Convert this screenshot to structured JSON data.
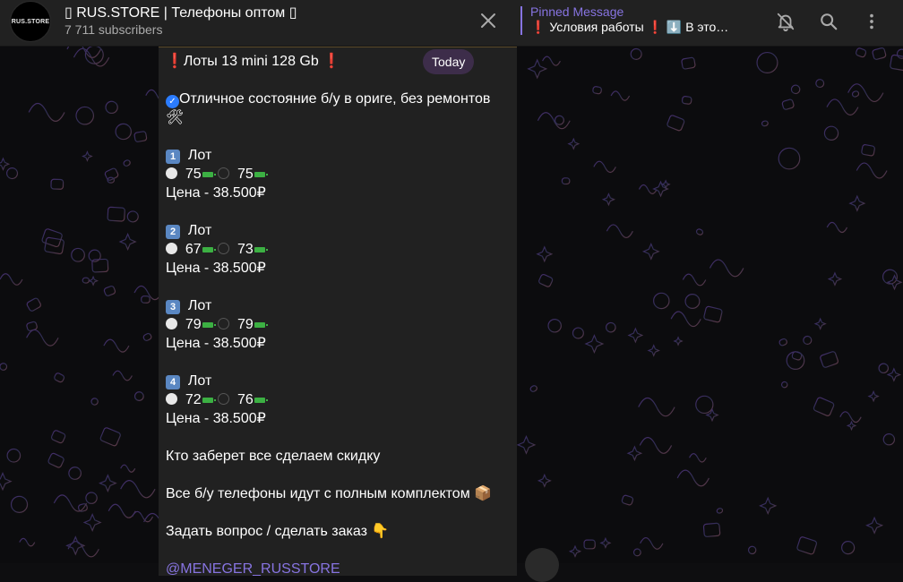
{
  "channel": {
    "avatar_text": "RUS.STORE",
    "title": "▯ RUS.STORE | Телефоны оптом ▯",
    "subscribers": "7 711 subscribers"
  },
  "pinned": {
    "title": "Pinned Message",
    "text": "❗ Условия работы ❗ ⬇️ В это…"
  },
  "header_icons": [
    "close-icon",
    "mute-bell-icon",
    "search-icon",
    "more-vertical-icon"
  ],
  "date_pill": "Today",
  "message": {
    "title": "Лоты  13 mini 128 Gb",
    "condition": "Отличное состояние б/у в ориге, без ремонтов",
    "lots": [
      {
        "num": "1",
        "label": "Лот",
        "white": "75",
        "black": "75",
        "price": "Цена - 38.500₽"
      },
      {
        "num": "2",
        "label": "Лот",
        "white": "67",
        "black": "73",
        "price": "Цена - 38.500₽"
      },
      {
        "num": "3",
        "label": "Лот",
        "white": "79",
        "black": "79",
        "price": "Цена - 38.500₽"
      },
      {
        "num": "4",
        "label": "Лот",
        "white": "72",
        "black": "76",
        "price": "Цена - 38.500₽"
      }
    ],
    "discount": "Кто заберет все сделаем скидку",
    "kit": "Все б/у телефоны идут с полным комплектом",
    "ask": "Задать вопрос / сделать заказ",
    "contact": "@MENEGER_RUSSTORE"
  },
  "colors": {
    "accent": "#8774e1",
    "header_bg": "#212121",
    "message_bg": "#212121",
    "date_pill_bg": "#3d2d4a",
    "battery_green": "#3cb043"
  }
}
